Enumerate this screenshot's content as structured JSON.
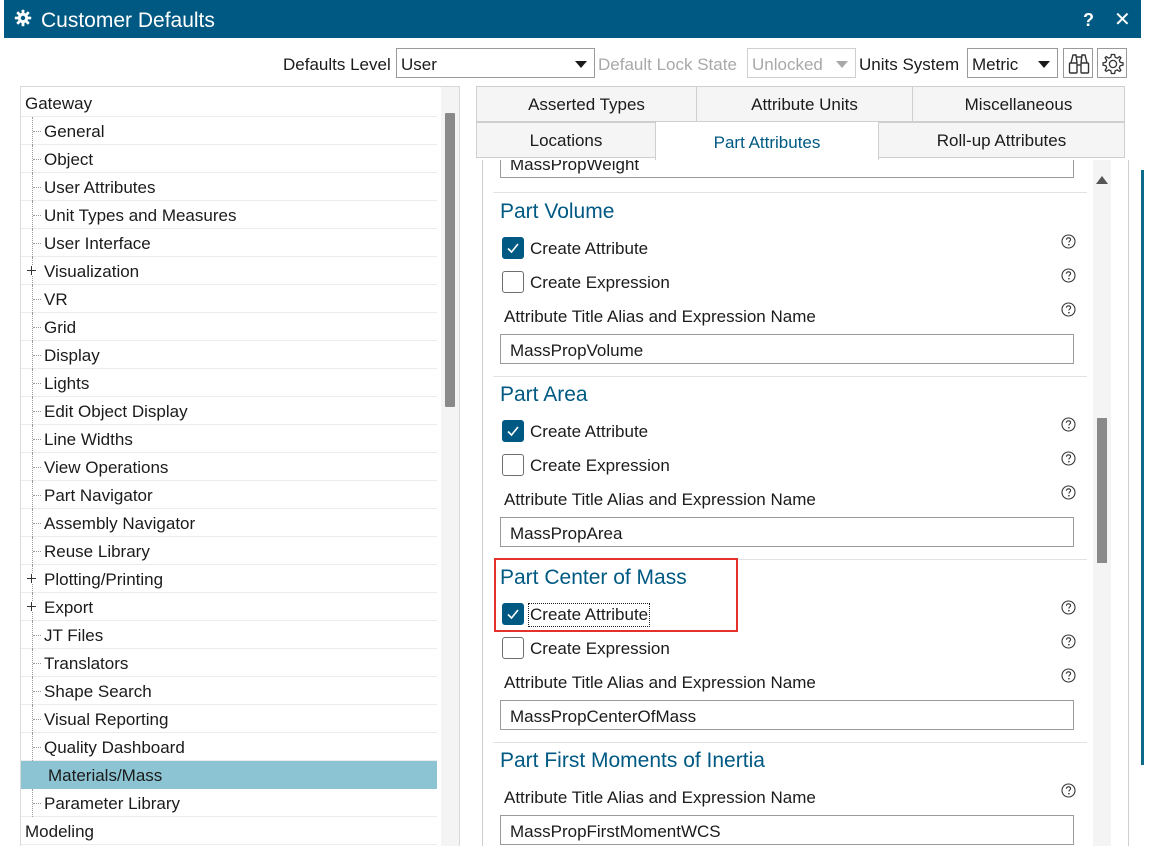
{
  "window": {
    "title": "Customer Defaults",
    "help_label": "?",
    "close_label": "✕"
  },
  "toolbar": {
    "defaults_level_label": "Defaults Level",
    "defaults_level_value": "User",
    "lock_state_label": "Default Lock State",
    "lock_state_value": "Unlocked",
    "units_label": "Units System",
    "units_value": "Metric",
    "search_icon": "binoculars-icon",
    "settings_icon": "gear-icon"
  },
  "tree": {
    "items": [
      {
        "label": "Gateway",
        "kind": "root"
      },
      {
        "label": "General",
        "kind": "child"
      },
      {
        "label": "Object",
        "kind": "child"
      },
      {
        "label": "User Attributes",
        "kind": "child"
      },
      {
        "label": "Unit Types and Measures",
        "kind": "child"
      },
      {
        "label": "User Interface",
        "kind": "child"
      },
      {
        "label": "Visualization",
        "kind": "expandable"
      },
      {
        "label": "VR",
        "kind": "child"
      },
      {
        "label": "Grid",
        "kind": "child"
      },
      {
        "label": "Display",
        "kind": "child"
      },
      {
        "label": "Lights",
        "kind": "child"
      },
      {
        "label": "Edit Object Display",
        "kind": "child"
      },
      {
        "label": "Line Widths",
        "kind": "child"
      },
      {
        "label": "View Operations",
        "kind": "child"
      },
      {
        "label": "Part Navigator",
        "kind": "child"
      },
      {
        "label": "Assembly Navigator",
        "kind": "child"
      },
      {
        "label": "Reuse Library",
        "kind": "child"
      },
      {
        "label": "Plotting/Printing",
        "kind": "expandable"
      },
      {
        "label": "Export",
        "kind": "expandable"
      },
      {
        "label": "JT Files",
        "kind": "child"
      },
      {
        "label": "Translators",
        "kind": "child"
      },
      {
        "label": "Shape Search",
        "kind": "child"
      },
      {
        "label": "Visual Reporting",
        "kind": "child"
      },
      {
        "label": "Quality Dashboard",
        "kind": "child"
      },
      {
        "label": "Materials/Mass",
        "kind": "selected"
      },
      {
        "label": "Parameter Library",
        "kind": "child"
      },
      {
        "label": "Modeling",
        "kind": "root"
      }
    ]
  },
  "tabs": {
    "row1": [
      "Asserted Types",
      "Attribute Units",
      "Miscellaneous"
    ],
    "row2": [
      "Locations",
      "Part Attributes",
      "Roll-up Attributes"
    ],
    "active": "Part Attributes"
  },
  "panel": {
    "top_field_value": "MassPropWeight",
    "sections": [
      {
        "title": "Part Volume",
        "create_attribute": "Create Attribute",
        "create_attribute_checked": true,
        "create_expression": "Create Expression",
        "create_expression_checked": false,
        "alias_label": "Attribute Title Alias and Expression Name",
        "alias_value": "MassPropVolume"
      },
      {
        "title": "Part Area",
        "create_attribute": "Create Attribute",
        "create_attribute_checked": true,
        "create_expression": "Create Expression",
        "create_expression_checked": false,
        "alias_label": "Attribute Title Alias and Expression Name",
        "alias_value": "MassPropArea"
      },
      {
        "title": "Part Center of Mass",
        "create_attribute": "Create Attribute",
        "create_attribute_checked": true,
        "create_expression": "Create Expression",
        "create_expression_checked": false,
        "alias_label": "Attribute Title Alias and Expression Name",
        "alias_value": "MassPropCenterOfMass"
      },
      {
        "title": "Part First Moments of Inertia",
        "alias_label": "Attribute Title Alias and Expression Name",
        "alias_value": "MassPropFirstMomentWCS"
      }
    ]
  },
  "colors": {
    "titlebar": "#005983",
    "accent": "#005983",
    "selection": "#8cc4d3",
    "annotation": "#e5312b"
  }
}
